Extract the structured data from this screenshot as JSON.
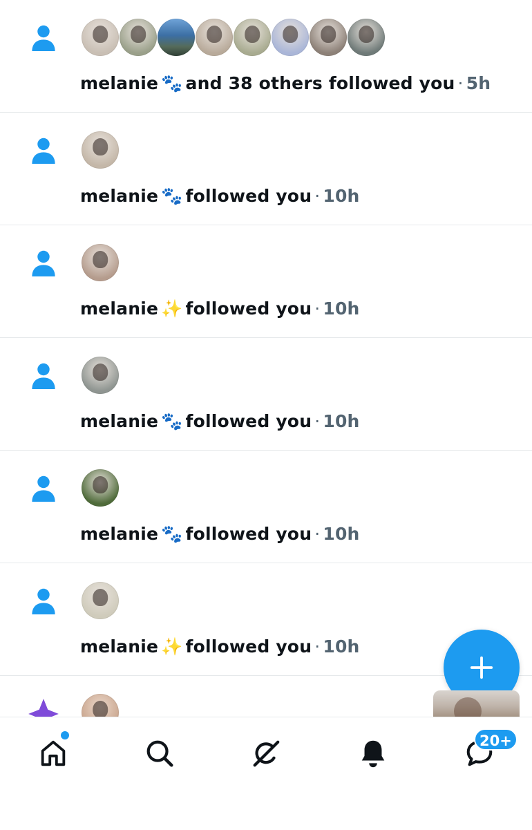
{
  "notifications": [
    {
      "name": "melanie",
      "emoji": "🐾",
      "action": "and 38 others followed you",
      "separator": "·",
      "time": "5h",
      "avatars": [
        "#c9bfb4",
        "#9aa08a",
        "#4a7fb5",
        "#b8aa9a",
        "#a8ab90",
        "#aab6d8",
        "#8d8178",
        "#6f7a78"
      ]
    },
    {
      "name": "melanie",
      "emoji": "🐾",
      "action": "followed you",
      "separator": "·",
      "time": "10h",
      "avatars": [
        "#c4b7a8"
      ]
    },
    {
      "name": "melanie",
      "emoji": "✨",
      "action": "followed you",
      "separator": "·",
      "time": "10h",
      "avatars": [
        "#b59c8d"
      ]
    },
    {
      "name": "melanie",
      "emoji": "🐾",
      "action": "followed you",
      "separator": "·",
      "time": "10h",
      "avatars": [
        "#8f9591"
      ]
    },
    {
      "name": "melanie",
      "emoji": "🐾",
      "action": "followed you",
      "separator": "·",
      "time": "10h",
      "avatars": [
        "#4f6b3a"
      ]
    },
    {
      "name": "melanie",
      "emoji": "✨",
      "action": "followed you",
      "separator": "·",
      "time": "10h",
      "avatars": [
        "#cfcbbb"
      ]
    }
  ],
  "partial_item": {
    "icon": "star-icon",
    "avatar_color": "#c9a58d"
  },
  "nav": {
    "items": [
      "home-icon",
      "search-icon",
      "grok-icon",
      "bell-icon",
      "messages-icon"
    ],
    "messages_badge": "20+"
  },
  "colors": {
    "accent": "#1d9bf0",
    "text": "#0f1419",
    "muted": "#536471",
    "divider": "#e6e9eb",
    "star": "#7f4bd9"
  }
}
